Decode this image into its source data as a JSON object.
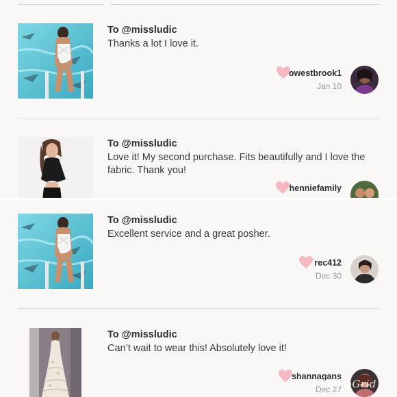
{
  "reviews": [
    {
      "to": "To @missludic",
      "message": "Thanks a lot I love it.",
      "username": "owestbrook1",
      "date": "Jan 10",
      "thumb_icon": "swimsuit-photo",
      "avatar_icon": "user-avatar"
    },
    {
      "to": "To @missludic",
      "message": "Love it! My second purchase. Fits beautifully and I love the fabric. Thank you!",
      "username": "henniefamily",
      "date": "",
      "thumb_icon": "black-top-photo",
      "avatar_icon": "user-avatar"
    },
    {
      "to": "To @missludic",
      "message": "Excellent service and a great posher.",
      "username": "rec412",
      "date": "Dec 30",
      "thumb_icon": "swimsuit-photo",
      "avatar_icon": "user-avatar"
    },
    {
      "to": "To @missludic",
      "message": "Can’t wait to wear this! Absolutely love it!",
      "username": "shannagans",
      "date": "Dec 27",
      "thumb_icon": "lace-dress-photo",
      "avatar_icon": "user-avatar"
    }
  ],
  "watermark": "PhotoGrid",
  "colors": {
    "heart": "#f6b8c2",
    "background": "#faf7f7",
    "divider": "#d8d4d4"
  }
}
